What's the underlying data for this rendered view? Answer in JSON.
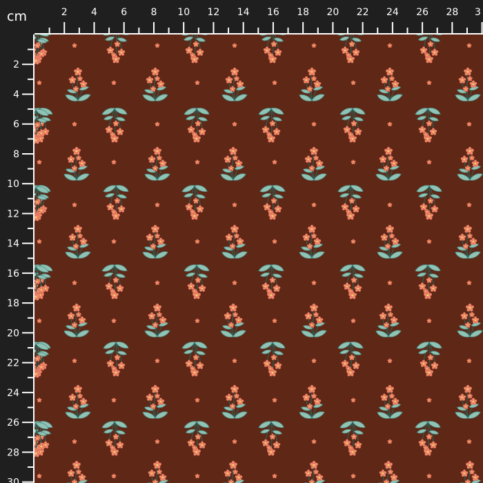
{
  "ruler": {
    "unit": "cm",
    "top_labels": [
      "2",
      "4",
      "6",
      "8",
      "10",
      "12",
      "14",
      "16",
      "18",
      "20",
      "22",
      "24",
      "26",
      "28",
      "3"
    ],
    "left_labels": [
      "2",
      "4",
      "6",
      "8",
      "10",
      "12",
      "14",
      "16",
      "18",
      "20",
      "22",
      "24",
      "26",
      "28",
      "30"
    ]
  },
  "colors": {
    "ruler_bg": "#1f1f1f",
    "ruler_tick": "#ffffff",
    "fabric_bg": "#5e2716",
    "petal": "#f08a6e",
    "petal_dark": "#d8674e",
    "flower_center": "#f3d36a",
    "leaf": "#8fc3b5",
    "leaf_dark": "#4f8a80",
    "stem": "#2f5c52",
    "dot": "#f08a6e"
  }
}
